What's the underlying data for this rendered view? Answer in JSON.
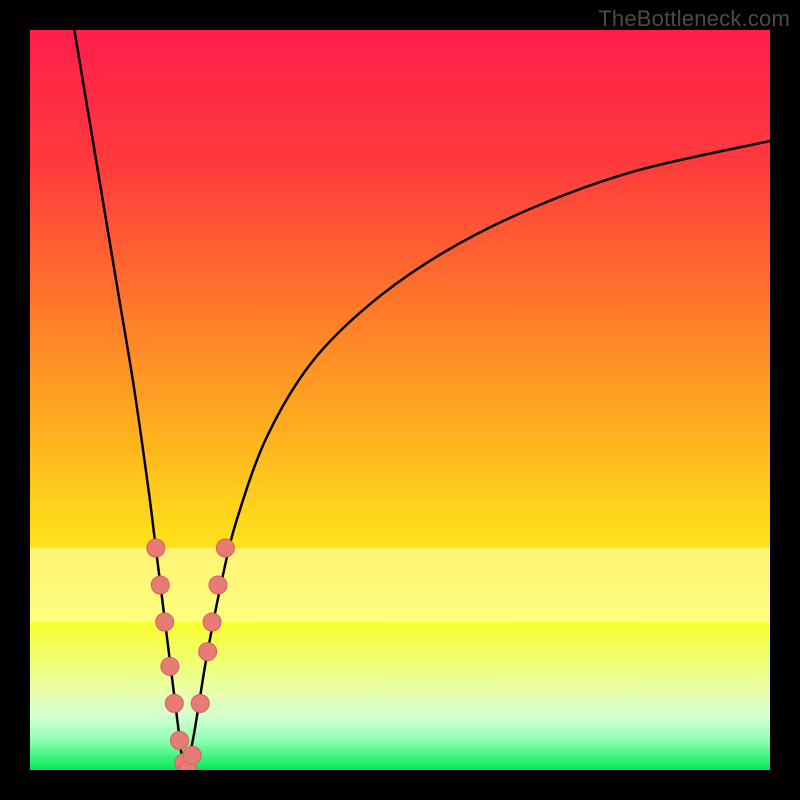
{
  "attribution": "TheBottleneck.com",
  "colors": {
    "gradient_stops": [
      {
        "offset": "0%",
        "color": "#ff1f4b"
      },
      {
        "offset": "18%",
        "color": "#ff3a3d"
      },
      {
        "offset": "38%",
        "color": "#ff7a2a"
      },
      {
        "offset": "55%",
        "color": "#ffb21e"
      },
      {
        "offset": "70%",
        "color": "#ffe41a"
      },
      {
        "offset": "80%",
        "color": "#f9ff2e"
      },
      {
        "offset": "86%",
        "color": "#eeff7a"
      },
      {
        "offset": "90%",
        "color": "#e6ffb3"
      },
      {
        "offset": "93%",
        "color": "#cfffd2"
      },
      {
        "offset": "96%",
        "color": "#8fffb0"
      },
      {
        "offset": "100%",
        "color": "#00e85a"
      }
    ],
    "curve": "#000000",
    "pale_band": "#ffffc0",
    "marker_fill": "#e77b76",
    "marker_stroke": "#d85f5a"
  },
  "chart_data": {
    "type": "line",
    "title": "",
    "xlabel": "",
    "ylabel": "",
    "xlim": [
      0,
      100
    ],
    "ylim": [
      0,
      100
    ],
    "grid": false,
    "legend": false,
    "series": [
      {
        "name": "bottleneck-curve-left",
        "x": [
          6,
          8,
          10,
          12,
          14,
          16,
          17,
          18,
          19,
          20,
          20.5,
          21
        ],
        "y": [
          100,
          88,
          76,
          64,
          52,
          38,
          30,
          22,
          14,
          6,
          2,
          0
        ]
      },
      {
        "name": "bottleneck-curve-right",
        "x": [
          21,
          22,
          23,
          24,
          26,
          28,
          32,
          38,
          46,
          56,
          68,
          82,
          100
        ],
        "y": [
          0,
          4,
          10,
          16,
          26,
          34,
          45,
          55,
          63,
          70,
          76,
          81,
          85
        ]
      }
    ],
    "markers": {
      "name": "highlighted-points",
      "points": [
        {
          "x": 17.0,
          "y": 30
        },
        {
          "x": 17.6,
          "y": 25
        },
        {
          "x": 18.2,
          "y": 20
        },
        {
          "x": 18.9,
          "y": 14
        },
        {
          "x": 19.5,
          "y": 9
        },
        {
          "x": 20.2,
          "y": 4
        },
        {
          "x": 20.8,
          "y": 1
        },
        {
          "x": 21.3,
          "y": 0
        },
        {
          "x": 21.9,
          "y": 2
        },
        {
          "x": 23.0,
          "y": 9
        },
        {
          "x": 24.0,
          "y": 16
        },
        {
          "x": 24.6,
          "y": 20
        },
        {
          "x": 25.4,
          "y": 25
        },
        {
          "x": 26.4,
          "y": 30
        }
      ]
    }
  }
}
